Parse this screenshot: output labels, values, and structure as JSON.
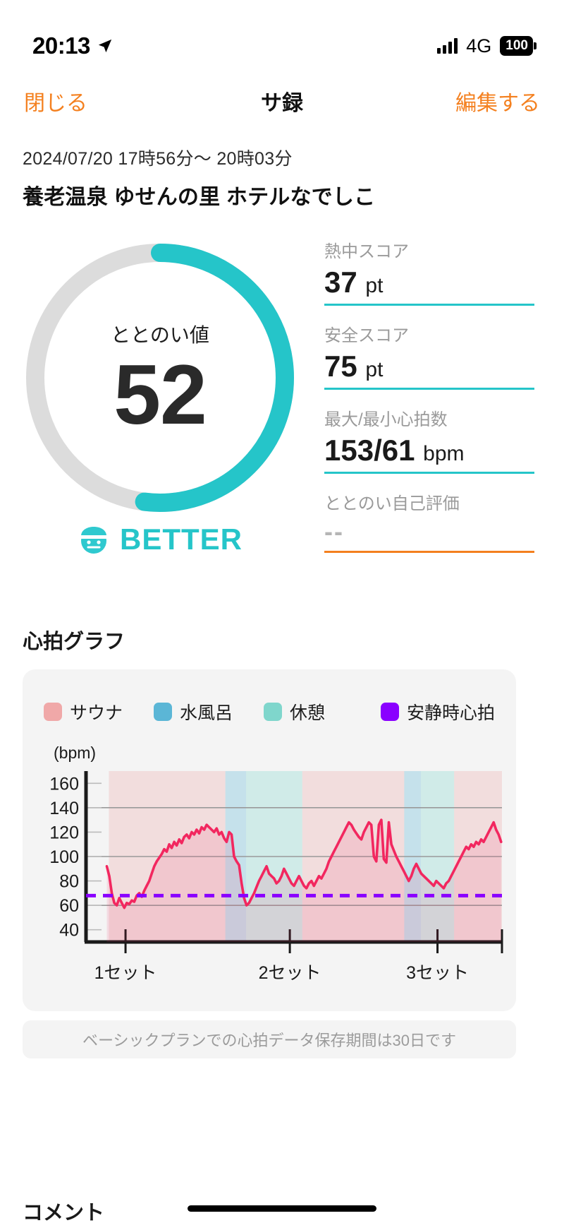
{
  "status_bar": {
    "time": "20:13",
    "location_icon": "location-arrow-icon",
    "signal_icon": "cellular-signal-icon",
    "network": "4G",
    "battery": "100"
  },
  "nav": {
    "close_label": "閉じる",
    "title": "サ録",
    "edit_label": "編集する"
  },
  "header": {
    "datetime": "2024/07/20 17時56分〜 20時03分",
    "venue": "養老温泉 ゆせんの里 ホテルなでしこ"
  },
  "score": {
    "ring_label": "ととのい値",
    "ring_value": "52",
    "ring_percent": 52,
    "rank_label": "BETTER",
    "rank_color": "#25c5c9",
    "ring_track_color": "#dcdcdc",
    "ring_fill_color": "#25c5c9",
    "sauna_icon": "sauna-hat-face-icon"
  },
  "stats": [
    {
      "label": "熱中スコア",
      "value": "37",
      "unit": "pt",
      "rule_color": "#25c5c9"
    },
    {
      "label": "安全スコア",
      "value": "75",
      "unit": "pt",
      "rule_color": "#25c5c9"
    },
    {
      "label": "最大/最小心拍数",
      "value": "153/61",
      "unit": "bpm",
      "rule_color": "#25c5c9"
    },
    {
      "label": "ととのい自己評価",
      "value": "--",
      "unit": "",
      "rule_color": "#f4801f"
    }
  ],
  "graph": {
    "section_title": "心拍グラフ",
    "unit_label": "(bpm)",
    "legend": [
      {
        "label": "サウナ",
        "color": "#f0a8a8"
      },
      {
        "label": "水風呂",
        "color": "#5bb6d6"
      },
      {
        "label": "休憩",
        "color": "#7fd6cc"
      },
      {
        "label": "安静時心拍",
        "color": "#8a00ff"
      }
    ]
  },
  "footnote": "ベーシックプランでの心拍データ保存期間は30日です",
  "comment": {
    "title": "コメント"
  },
  "chart_data": {
    "type": "line",
    "title": "心拍グラフ",
    "ylabel": "(bpm)",
    "xlabel": "",
    "ylim": [
      30,
      170
    ],
    "yticks": [
      160,
      140,
      120,
      100,
      80,
      60,
      40
    ],
    "gridlines": [
      140,
      100,
      60
    ],
    "grid": true,
    "legend_position": "top",
    "xticks": [
      {
        "label": "1セット",
        "x_pct": 9.5
      },
      {
        "label": "2セット",
        "x_pct": 49.0
      },
      {
        "label": "3セット",
        "x_pct": 84.5
      },
      {
        "label": "",
        "x_pct": 100
      }
    ],
    "resting_hr": {
      "label": "安静時心拍",
      "value": 68,
      "color": "#8a00ff",
      "style": "dashed"
    },
    "phase_bands": [
      {
        "type": "サウナ",
        "color": "#f0a8a8",
        "start_pct": 5.5,
        "end_pct": 33.5
      },
      {
        "type": "水風呂",
        "color": "#5bb6d6",
        "start_pct": 33.5,
        "end_pct": 38.5
      },
      {
        "type": "休憩",
        "color": "#7fd6cc",
        "start_pct": 38.5,
        "end_pct": 52.0
      },
      {
        "type": "サウナ",
        "color": "#f0a8a8",
        "start_pct": 52.0,
        "end_pct": 76.5
      },
      {
        "type": "水風呂",
        "color": "#5bb6d6",
        "start_pct": 76.5,
        "end_pct": 80.5
      },
      {
        "type": "休憩",
        "color": "#7fd6cc",
        "start_pct": 80.5,
        "end_pct": 88.5
      },
      {
        "type": "サウナ",
        "color": "#f0a8a8",
        "start_pct": 88.5,
        "end_pct": 100
      }
    ],
    "series": [
      {
        "name": "心拍数",
        "color": "#f2275f",
        "x": [
          5.0,
          5.6,
          6.2,
          6.8,
          7.4,
          8.0,
          8.6,
          9.2,
          9.8,
          10.4,
          11.0,
          11.6,
          12.2,
          12.8,
          13.4,
          14.0,
          14.6,
          15.2,
          15.8,
          16.4,
          17.0,
          17.6,
          18.2,
          18.8,
          19.4,
          20.0,
          20.6,
          21.2,
          21.8,
          22.4,
          23.0,
          23.6,
          24.2,
          24.8,
          25.4,
          26.0,
          26.6,
          27.2,
          27.8,
          28.4,
          29.0,
          29.6,
          30.2,
          30.8,
          31.4,
          32.0,
          32.6,
          33.2,
          33.8,
          34.4,
          35.0,
          35.6,
          36.2,
          36.8,
          37.4,
          38.0,
          38.6,
          39.2,
          39.8,
          40.4,
          41.0,
          41.6,
          42.2,
          42.8,
          43.4,
          44.0,
          44.6,
          45.2,
          45.8,
          46.4,
          47.0,
          47.6,
          48.2,
          48.8,
          49.4,
          50.0,
          50.6,
          51.2,
          51.8,
          52.4,
          53.0,
          53.6,
          54.2,
          54.8,
          55.4,
          56.0,
          56.6,
          57.2,
          57.8,
          58.4,
          59.0,
          59.6,
          60.2,
          60.8,
          61.4,
          62.0,
          62.6,
          63.2,
          63.8,
          64.4,
          65.0,
          65.6,
          66.2,
          66.8,
          67.4,
          68.0,
          68.6,
          69.2,
          69.8,
          70.4,
          71.0,
          71.6,
          72.2,
          72.8,
          73.4,
          74.0,
          74.6,
          75.2,
          75.8,
          76.4,
          77.0,
          77.6,
          78.2,
          78.8,
          79.4,
          80.0,
          80.6,
          81.2,
          81.8,
          82.4,
          83.0,
          83.6,
          84.2,
          84.8,
          85.4,
          86.0,
          86.6,
          87.2,
          87.8,
          88.4,
          89.0,
          89.6,
          90.2,
          90.8,
          91.4,
          92.0,
          92.6,
          93.2,
          93.8,
          94.4,
          95.0,
          95.6,
          96.2,
          96.8,
          97.4,
          98.0,
          98.6,
          99.2,
          99.8
        ],
        "y": [
          92,
          84,
          70,
          62,
          60,
          66,
          62,
          58,
          62,
          61,
          64,
          63,
          68,
          70,
          67,
          72,
          76,
          80,
          86,
          92,
          96,
          99,
          102,
          106,
          104,
          110,
          107,
          112,
          109,
          114,
          111,
          116,
          118,
          115,
          120,
          118,
          122,
          119,
          124,
          122,
          126,
          124,
          122,
          120,
          123,
          118,
          120,
          115,
          112,
          120,
          118,
          100,
          96,
          93,
          78,
          66,
          60,
          62,
          66,
          70,
          75,
          80,
          84,
          88,
          92,
          86,
          84,
          82,
          78,
          80,
          84,
          90,
          86,
          82,
          78,
          76,
          80,
          84,
          80,
          76,
          74,
          78,
          80,
          76,
          80,
          84,
          82,
          86,
          90,
          96,
          100,
          104,
          108,
          112,
          116,
          120,
          124,
          128,
          126,
          122,
          119,
          116,
          114,
          120,
          124,
          128,
          126,
          100,
          96,
          126,
          130,
          98,
          95,
          128,
          110,
          105,
          100,
          96,
          92,
          88,
          84,
          80,
          84,
          90,
          94,
          90,
          86,
          84,
          82,
          80,
          78,
          76,
          80,
          78,
          76,
          74,
          78,
          80,
          84,
          88,
          92,
          96,
          100,
          104,
          108,
          106,
          110,
          108,
          112,
          110,
          114,
          112,
          116,
          120,
          124,
          128,
          122,
          118,
          112,
          108
        ]
      }
    ]
  }
}
